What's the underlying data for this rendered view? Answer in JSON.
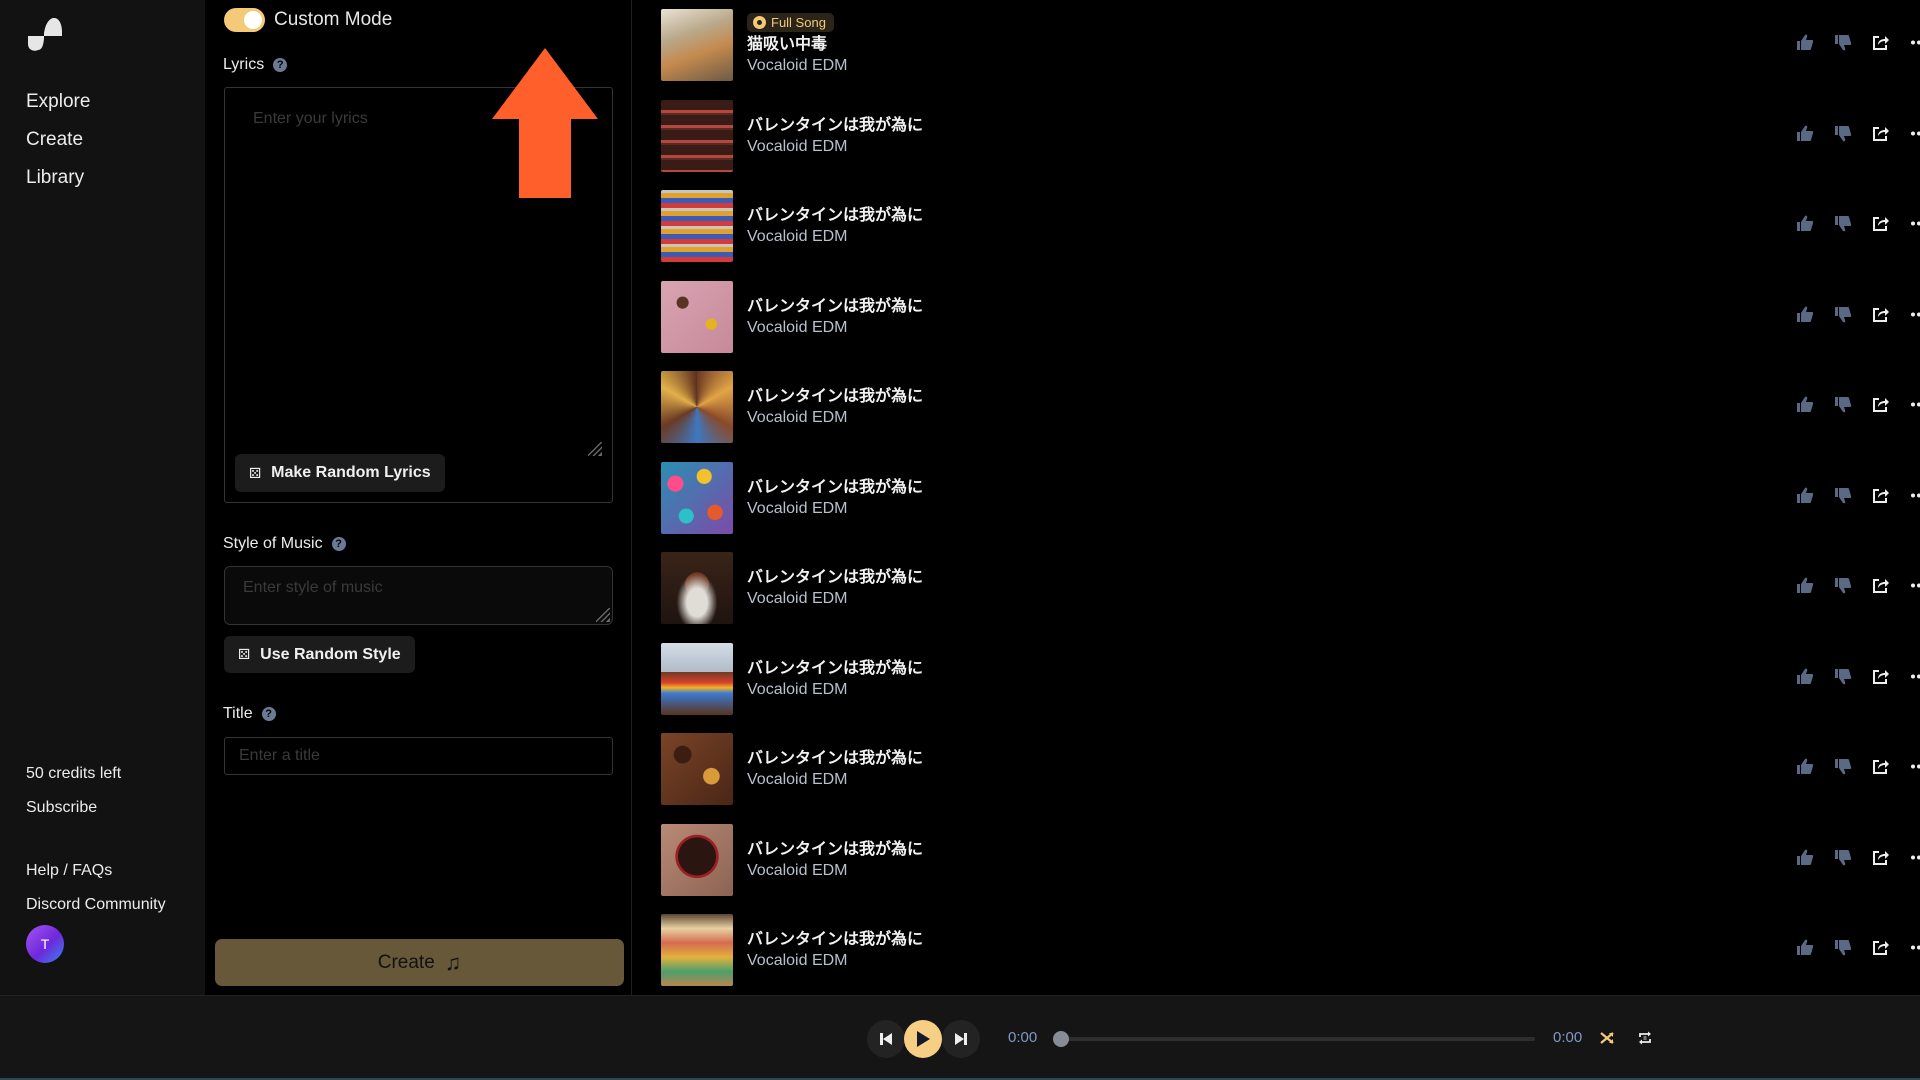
{
  "sidebar": {
    "logo": "suno-wave-logo",
    "nav": [
      {
        "label": "Explore"
      },
      {
        "label": "Create"
      },
      {
        "label": "Library"
      }
    ],
    "credits": "50 credits left",
    "subscribe": "Subscribe",
    "help": "Help / FAQs",
    "discord": "Discord Community",
    "avatar_initial": "T"
  },
  "form": {
    "custom_mode": {
      "label": "Custom Mode",
      "enabled": true
    },
    "lyrics": {
      "label": "Lyrics",
      "placeholder": "Enter your lyrics",
      "value": "",
      "random_button": "Make Random Lyrics"
    },
    "style": {
      "label": "Style of Music",
      "placeholder": "Enter style of music",
      "value": "",
      "random_button": "Use Random Style"
    },
    "title": {
      "label": "Title",
      "placeholder": "Enter a title",
      "value": ""
    },
    "create_button": "Create",
    "help_glyph": "?"
  },
  "annotation": {
    "type": "arrow-up",
    "color": "#ff5f2a"
  },
  "songs": [
    {
      "title": "猫吸い中毒",
      "style": "Vocaloid EDM",
      "badge": "Full Song",
      "thumb": "cat-in-living-room"
    },
    {
      "title": "バレンタインは我が為に",
      "style": "Vocaloid EDM",
      "badge": null,
      "thumb": "chocolate-shelf"
    },
    {
      "title": "バレンタインは我が為に",
      "style": "Vocaloid EDM",
      "badge": null,
      "thumb": "candy-store-shelves"
    },
    {
      "title": "バレンタインは我が為に",
      "style": "Vocaloid EDM",
      "badge": null,
      "thumb": "pink-chocolate-bars"
    },
    {
      "title": "バレンタインは我が為に",
      "style": "Vocaloid EDM",
      "badge": null,
      "thumb": "chocolate-swirl"
    },
    {
      "title": "バレンタインは我が為に",
      "style": "Vocaloid EDM",
      "badge": null,
      "thumb": "colorful-candies"
    },
    {
      "title": "バレンタインは我が為に",
      "style": "Vocaloid EDM",
      "badge": null,
      "thumb": "chocolate-cake-plate"
    },
    {
      "title": "バレンタインは我が為に",
      "style": "Vocaloid EDM",
      "badge": null,
      "thumb": "chocolate-mountain"
    },
    {
      "title": "バレンタインは我が為に",
      "style": "Vocaloid EDM",
      "badge": null,
      "thumb": "chocolate-bonbons"
    },
    {
      "title": "バレンタインは我が為に",
      "style": "Vocaloid EDM",
      "badge": null,
      "thumb": "heart-chocolate-box"
    },
    {
      "title": "バレンタインは我が為に",
      "style": "Vocaloid EDM",
      "badge": null,
      "thumb": "candy-aisle"
    }
  ],
  "song_actions": [
    "thumbs-up",
    "thumbs-down",
    "share",
    "more"
  ],
  "player": {
    "current_time": "0:00",
    "duration": "0:00",
    "progress": 0,
    "shuffle_active": true,
    "repeat_mode": "repeat-one"
  },
  "colors": {
    "accent": "#f4c978",
    "create_button": "#67583a",
    "annotation_arrow": "#ff5f2a",
    "icon_muted": "#5a6a84",
    "time_text": "#7e9ac3"
  }
}
